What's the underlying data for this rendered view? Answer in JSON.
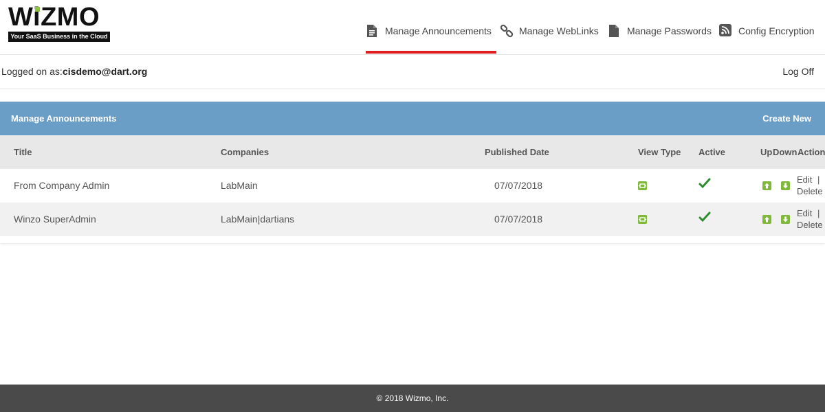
{
  "logo": {
    "word": "WiZMO",
    "tagline": "Your SaaS Business in the Cloud"
  },
  "nav": [
    {
      "label": "Manage Announcements",
      "icon": "document-icon",
      "active": true
    },
    {
      "label": "Manage WebLinks",
      "icon": "link-icon",
      "active": false
    },
    {
      "label": "Manage Passwords",
      "icon": "file-icon",
      "active": false
    },
    {
      "label": "Config Encryption",
      "icon": "rss-icon",
      "active": false
    }
  ],
  "userbar": {
    "label": "Logged on as:",
    "user": "cisdemo@dart.org",
    "logoff": "Log Off"
  },
  "panel": {
    "title": "Manage Announcements",
    "create_new": "Create New",
    "columns": [
      "Title",
      "Companies",
      "Published Date",
      "View Type",
      "Active",
      "Up",
      "Down",
      "Action"
    ],
    "rows": [
      {
        "title": "From Company Admin",
        "companies": "LabMain",
        "published": "07/07/2018",
        "active": true
      },
      {
        "title": "Winzo SuperAdmin",
        "companies": "LabMain|dartians",
        "published": "07/07/2018",
        "active": true
      }
    ],
    "action_edit": "Edit",
    "action_sep": "|",
    "action_delete": "Delete"
  },
  "footer": {
    "copyright": "© 2018 Wizmo, Inc."
  },
  "colors": {
    "panel_header": "#6b9ec7",
    "accent_red": "#e02020",
    "icon_green": "#7fb83a",
    "check_green": "#2e8b2e",
    "footer": "#4a4a4a"
  }
}
